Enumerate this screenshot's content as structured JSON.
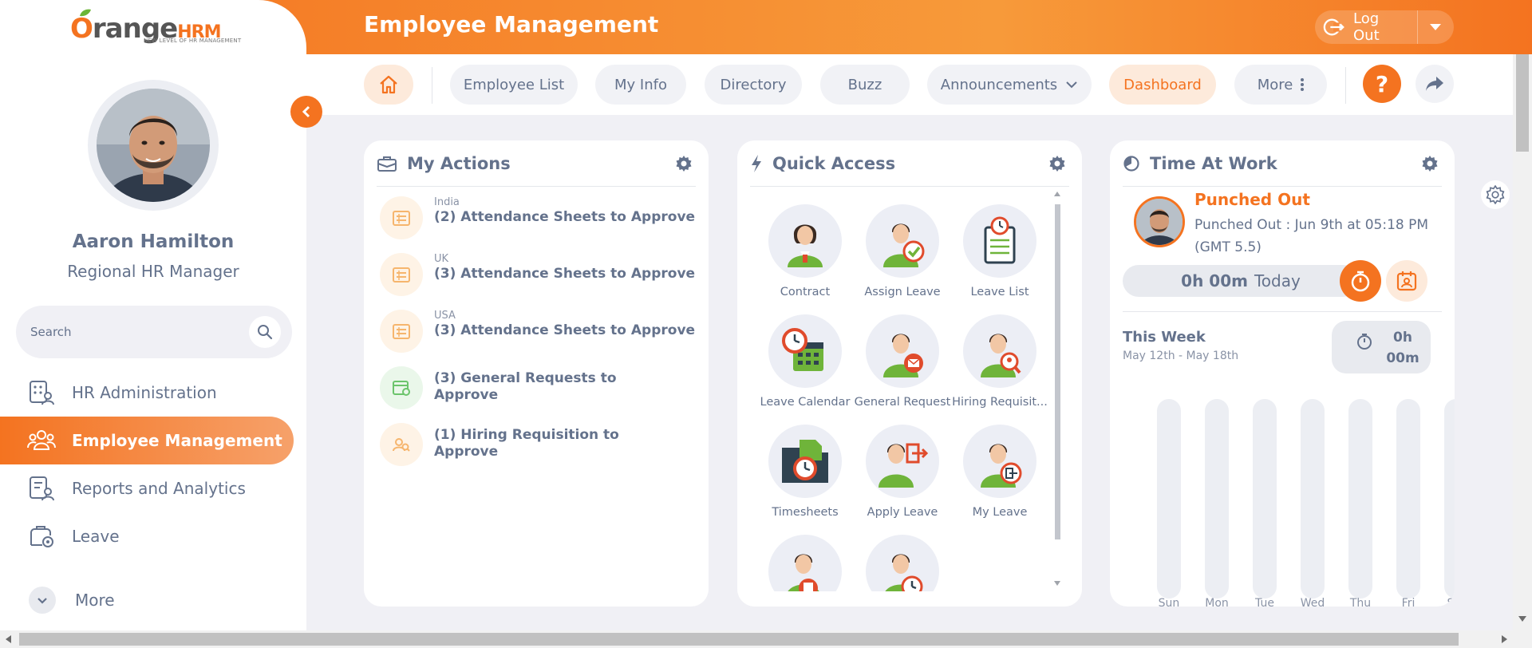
{
  "header": {
    "title": "Employee Management",
    "logout_label": "Log Out"
  },
  "logo": {
    "brand_o": "O",
    "brand_rest": "range",
    "brand_hrm": "HRM",
    "tagline": "NEW LEVEL OF HR MANAGEMENT"
  },
  "user": {
    "name": "Aaron Hamilton",
    "role": "Regional HR Manager"
  },
  "search": {
    "placeholder": "Search"
  },
  "sidebar": {
    "items": [
      {
        "label": "HR Administration",
        "active": false
      },
      {
        "label": "Employee Management",
        "active": true
      },
      {
        "label": "Reports and Analytics",
        "active": false
      },
      {
        "label": "Leave",
        "active": false
      }
    ],
    "more_label": "More"
  },
  "nav": {
    "items": [
      "Employee List",
      "My Info",
      "Directory",
      "Buzz",
      "Announcements",
      "Dashboard",
      "More"
    ],
    "active": "Dashboard",
    "help_label": "?"
  },
  "my_actions": {
    "title": "My Actions",
    "items": [
      {
        "region": "India",
        "title": "(2) Attendance Sheets to Approve"
      },
      {
        "region": "UK",
        "title": "(3) Attendance Sheets to Approve"
      },
      {
        "region": "USA",
        "title": "(3) Attendance Sheets to Approve"
      },
      {
        "region": "",
        "title_line1": "(3) General Requests to",
        "title_line2": "Approve"
      },
      {
        "region": "",
        "title_line1": "(1) Hiring Requisition to",
        "title_line2": "Approve"
      }
    ]
  },
  "quick_access": {
    "title": "Quick Access",
    "items": [
      "Contract",
      "Assign Leave",
      "Leave List",
      "Leave Calendar",
      "General Request",
      "Hiring Requisit...",
      "Timesheets",
      "Apply Leave",
      "My Leave",
      "",
      ""
    ]
  },
  "time_at_work": {
    "title": "Time At Work",
    "status": "Punched Out",
    "detail": "Punched Out : Jun 9th at 05:18 PM (GMT 5.5)",
    "today_value": "0h 00m",
    "today_label": "Today",
    "week_label": "This Week",
    "week_range": "May 12th - May 18th",
    "week_total_line1": "0h",
    "week_total_line2": "00m",
    "days": [
      "Sun",
      "Mon",
      "Tue",
      "Wed",
      "Thu",
      "Fri",
      "Sat"
    ]
  },
  "colors": {
    "accent": "#f47320",
    "text": "#64728c",
    "background": "#f0f0f5"
  }
}
